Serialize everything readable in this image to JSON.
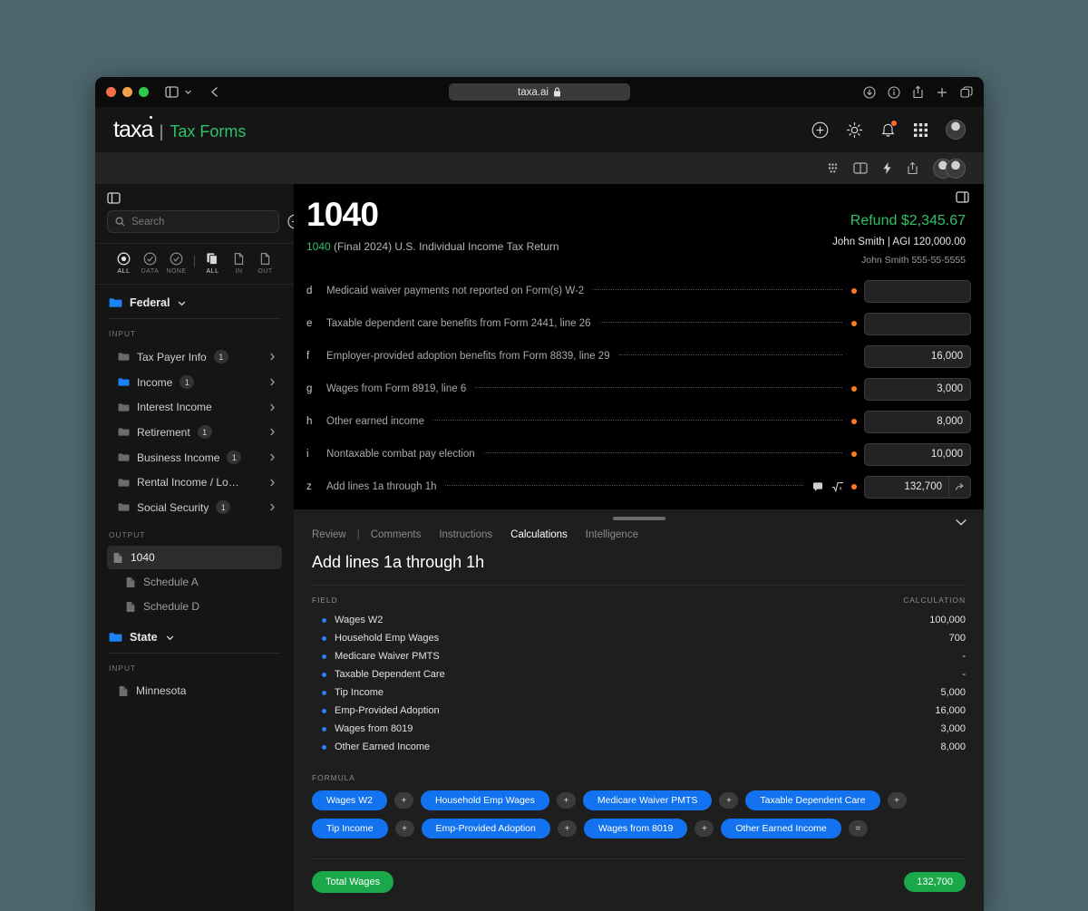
{
  "browser": {
    "url": "taxa.ai",
    "lock_icon": "lock-icon"
  },
  "app": {
    "brand": "taxa",
    "brand_divider": "|",
    "brand_section": "Tax Forms"
  },
  "sidebar": {
    "search_placeholder": "Search",
    "filters": [
      {
        "label": "ALL",
        "icon": "target-icon",
        "active": true
      },
      {
        "label": "DATA",
        "icon": "check-circle-icon",
        "active": false
      },
      {
        "label": "NONE",
        "icon": "check-circle-icon",
        "active": false
      },
      {
        "label": "ALL",
        "icon": "documents-icon",
        "active": true
      },
      {
        "label": "IN",
        "icon": "document-icon",
        "active": false
      },
      {
        "label": "OUT",
        "icon": "document-icon",
        "active": false
      }
    ],
    "federal": {
      "label": "Federal",
      "icon": "folder-icon"
    },
    "federal_input_label": "INPUT",
    "federal_input_items": [
      {
        "label": "Tax Payer Info",
        "badge": "1",
        "chevron": true,
        "folder": "grey"
      },
      {
        "label": "Income",
        "badge": "1",
        "chevron": true,
        "folder": "blue"
      },
      {
        "label": "Interest Income",
        "badge": "",
        "chevron": true,
        "folder": "grey"
      },
      {
        "label": "Retirement",
        "badge": "1",
        "chevron": true,
        "folder": "grey"
      },
      {
        "label": "Business Income",
        "badge": "1",
        "chevron": true,
        "folder": "grey"
      },
      {
        "label": "Rental Income / Lo…",
        "badge": "",
        "chevron": true,
        "folder": "grey"
      },
      {
        "label": "Social Security",
        "badge": "1",
        "chevron": true,
        "folder": "grey"
      }
    ],
    "federal_output_label": "OUTPUT",
    "federal_output_items": [
      {
        "label": "1040",
        "active": true,
        "sub": false
      },
      {
        "label": "Schedule A",
        "active": false,
        "sub": true
      },
      {
        "label": "Schedule D",
        "active": false,
        "sub": true
      }
    ],
    "state": {
      "label": "State",
      "icon": "folder-icon"
    },
    "state_input_label": "INPUT",
    "state_input_items": [
      {
        "label": "Minnesota",
        "active": false
      }
    ]
  },
  "form": {
    "title": "1040",
    "subtitle_code": "1040",
    "subtitle_rest": " (Final 2024) U.S. Individual Income Tax Return",
    "refund": "Refund $2,345.67",
    "taxpayer": "John Smith | AGI 120,000.00",
    "ssn": "John Smith 555-55-5555",
    "rows": [
      {
        "letter": "d",
        "text": "Medicaid waiver payments not reported on Form(s) W-2",
        "value": "",
        "dot": true,
        "icons": false,
        "button": false
      },
      {
        "letter": "e",
        "text": "Taxable dependent care benefits from Form 2441, line 26",
        "value": "",
        "dot": true,
        "icons": false,
        "button": false
      },
      {
        "letter": "f",
        "text": "Employer-provided adoption benefits from Form 8839, line 29",
        "value": "16,000",
        "dot": false,
        "icons": false,
        "button": false
      },
      {
        "letter": "g",
        "text": "Wages from Form 8919, line 6",
        "value": "3,000",
        "dot": true,
        "icons": false,
        "button": false
      },
      {
        "letter": "h",
        "text": "Other earned income",
        "value": "8,000",
        "dot": true,
        "icons": false,
        "button": false
      },
      {
        "letter": "i",
        "text": "Nontaxable combat pay election",
        "value": "10,000",
        "dot": true,
        "icons": false,
        "button": false
      },
      {
        "letter": "z",
        "text": "Add lines 1a through 1h",
        "value": "132,700",
        "dot": true,
        "icons": true,
        "button": true
      }
    ]
  },
  "panel": {
    "tabs": [
      {
        "label": "Review",
        "active": false
      },
      {
        "label": "Comments",
        "active": false
      },
      {
        "label": "Instructions",
        "active": false
      },
      {
        "label": "Calculations",
        "active": true
      },
      {
        "label": "Intelligence",
        "active": false
      }
    ],
    "tab_divider": "|",
    "title": "Add lines 1a through 1h",
    "col_field": "FIELD",
    "col_calculation": "CALCULATION",
    "rows": [
      {
        "field": "Wages W2",
        "value": "100,000"
      },
      {
        "field": "Household Emp Wages",
        "value": "700"
      },
      {
        "field": "Medicare Waiver PMTS",
        "value": "-"
      },
      {
        "field": "Taxable Dependent Care",
        "value": "-"
      },
      {
        "field": "Tip Income",
        "value": "5,000"
      },
      {
        "field": "Emp-Provided Adoption",
        "value": "16,000"
      },
      {
        "field": "Wages from 8019",
        "value": "3,000"
      },
      {
        "field": "Other Earned Income",
        "value": "8,000"
      }
    ],
    "formula_label": "FORMULA",
    "formula_row1": [
      {
        "chip": "Wages W2",
        "op": "+"
      },
      {
        "chip": "Household Emp Wages",
        "op": "+"
      },
      {
        "chip": "Medicare Waiver PMTS",
        "op": "+"
      },
      {
        "chip": "Taxable Dependent Care",
        "op": "+"
      }
    ],
    "formula_row2": [
      {
        "chip": "Tip Income",
        "op": "+"
      },
      {
        "chip": "Emp-Provided Adoption",
        "op": "+"
      },
      {
        "chip": "Wages from 8019",
        "op": "+"
      },
      {
        "chip": "Other Earned Income",
        "op": "="
      }
    ],
    "total_label": "Total Wages",
    "total_value": "132,700"
  },
  "colors": {
    "page_bg": "#4d666d",
    "accent_green": "#2ec267",
    "accent_blue": "#1272ef",
    "accent_orange": "#ff7a26",
    "total_green": "#1aa84a"
  }
}
